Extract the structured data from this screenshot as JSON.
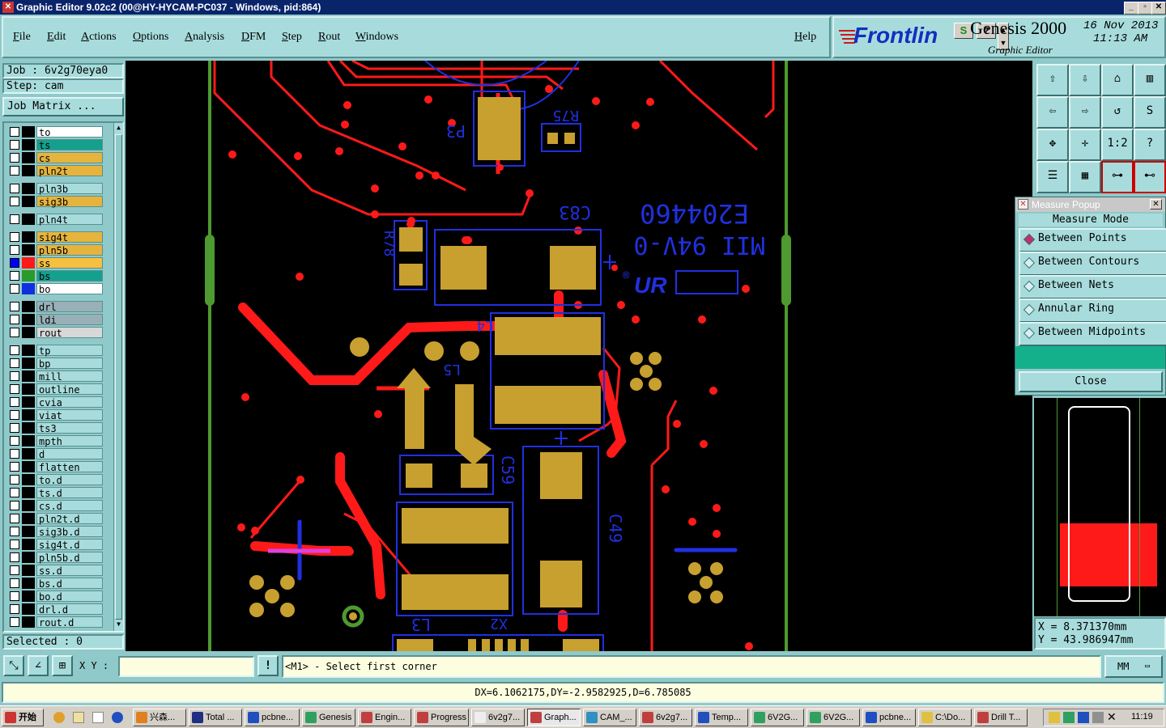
{
  "window": {
    "title": "Graphic Editor 9.02c2 (00@HY-HYCAM-PC037 - Windows, pid:864)"
  },
  "menu": [
    "File",
    "Edit",
    "Actions",
    "Options",
    "Analysis",
    "DFM",
    "Step",
    "Rout",
    "Windows"
  ],
  "help_label": "Help",
  "brand": {
    "logo": "Frontlin",
    "product": "Genesis 2000",
    "subtitle": "Graphic Editor",
    "date": "16 Nov 2013",
    "time": "11:13 AM"
  },
  "job": {
    "job_label": "Job : 6v2g70eya0",
    "step_label": "Step: cam",
    "matrix_button": "Job Matrix ..."
  },
  "layers": [
    {
      "name": "to",
      "color": "#ffffff",
      "state": "none"
    },
    {
      "name": "ts",
      "color": "#14a08c",
      "state": "none"
    },
    {
      "name": "cs",
      "color": "#e6b43c",
      "state": "none"
    },
    {
      "name": "pln2t",
      "color": "#e6b43c",
      "state": "none"
    },
    {
      "name": "pln3b",
      "color": "#a8dcdc",
      "state": "none"
    },
    {
      "name": "sig3b",
      "color": "#e6b43c",
      "state": "none"
    },
    {
      "name": "pln4t",
      "color": "#a8dcdc",
      "state": "none"
    },
    {
      "name": "sig4t",
      "color": "#e6b43c",
      "state": "none"
    },
    {
      "name": "pln5b",
      "color": "#e6b43c",
      "state": "none"
    },
    {
      "name": "ss",
      "color": "#f5c040",
      "state": "work"
    },
    {
      "name": "bs",
      "color": "#14a08c",
      "state": "display"
    },
    {
      "name": "bo",
      "color": "#ffffff",
      "state": "display"
    },
    {
      "name": "drl",
      "color": "#9ab0b8",
      "state": "none"
    },
    {
      "name": "ldi",
      "color": "#9ab0b8",
      "state": "none"
    },
    {
      "name": "rout",
      "color": "#d8d8d8",
      "state": "none"
    },
    {
      "name": "tp",
      "color": "#a8dcdc",
      "state": "none"
    },
    {
      "name": "bp",
      "color": "#a8dcdc",
      "state": "none"
    },
    {
      "name": "mill",
      "color": "#a8dcdc",
      "state": "none"
    },
    {
      "name": "outline",
      "color": "#a8dcdc",
      "state": "none"
    },
    {
      "name": "cvia",
      "color": "#a8dcdc",
      "state": "none"
    },
    {
      "name": "viat",
      "color": "#a8dcdc",
      "state": "none"
    },
    {
      "name": "ts3",
      "color": "#a8dcdc",
      "state": "none"
    },
    {
      "name": "mpth",
      "color": "#a8dcdc",
      "state": "none"
    },
    {
      "name": "d",
      "color": "#a8dcdc",
      "state": "none"
    },
    {
      "name": "flatten",
      "color": "#a8dcdc",
      "state": "none"
    },
    {
      "name": "to.d",
      "color": "#a8dcdc",
      "state": "none"
    },
    {
      "name": "ts.d",
      "color": "#a8dcdc",
      "state": "none"
    },
    {
      "name": "cs.d",
      "color": "#a8dcdc",
      "state": "none"
    },
    {
      "name": "pln2t.d",
      "color": "#a8dcdc",
      "state": "none"
    },
    {
      "name": "sig3b.d",
      "color": "#a8dcdc",
      "state": "none"
    },
    {
      "name": "sig4t.d",
      "color": "#a8dcdc",
      "state": "none"
    },
    {
      "name": "pln5b.d",
      "color": "#a8dcdc",
      "state": "none"
    },
    {
      "name": "ss.d",
      "color": "#a8dcdc",
      "state": "none"
    },
    {
      "name": "bs.d",
      "color": "#a8dcdc",
      "state": "none"
    },
    {
      "name": "bo.d",
      "color": "#a8dcdc",
      "state": "none"
    },
    {
      "name": "drl.d",
      "color": "#a8dcdc",
      "state": "none"
    },
    {
      "name": "rout.d",
      "color": "#a8dcdc",
      "state": "none"
    }
  ],
  "selected_label": "Selected : 0",
  "canvas_labels": {
    "p3": "P3",
    "r75": "R75",
    "c83": "C83",
    "r78": "R78",
    "l4": "L4",
    "l5": "L5",
    "c59": "C59",
    "c49": "C49",
    "l3": "L3",
    "x2": "X2",
    "part_no": "E204460",
    "material": "MII 94V-0",
    "ul_logo": "UR",
    "registered": "®"
  },
  "measure_popup": {
    "title": "Measure Popup",
    "mode_label": "Measure Mode",
    "options": [
      "Between Points",
      "Between Contours",
      "Between Nets",
      "Annular Ring",
      "Between Midpoints"
    ],
    "selected_index": 0,
    "close_label": "Close"
  },
  "coords": {
    "x": "X = 8.371370mm",
    "y": "Y = 43.986947mm"
  },
  "command": {
    "xy_label": "X Y :",
    "xy_value": "",
    "prompt": "<M1> - Select first corner",
    "units": "MM"
  },
  "status_line": "DX=6.1062175,DY=-2.9582925,D=6.785085",
  "taskbar": {
    "start": "开始",
    "tasks": [
      "兴森...",
      "Total ...",
      "pcbne...",
      "Genesis",
      "Engin...",
      "Progress",
      "6v2g7...",
      "Graph...",
      "CAM_...",
      "6v2g7...",
      "Temp...",
      "6V2G...",
      "6V2G...",
      "pcbne...",
      "C:\\Do...",
      "Drill T..."
    ],
    "clock": "11:19"
  },
  "colors": {
    "signal": "#ff1a1a",
    "pad": "#c8a030",
    "silk": "#2030e0"
  }
}
